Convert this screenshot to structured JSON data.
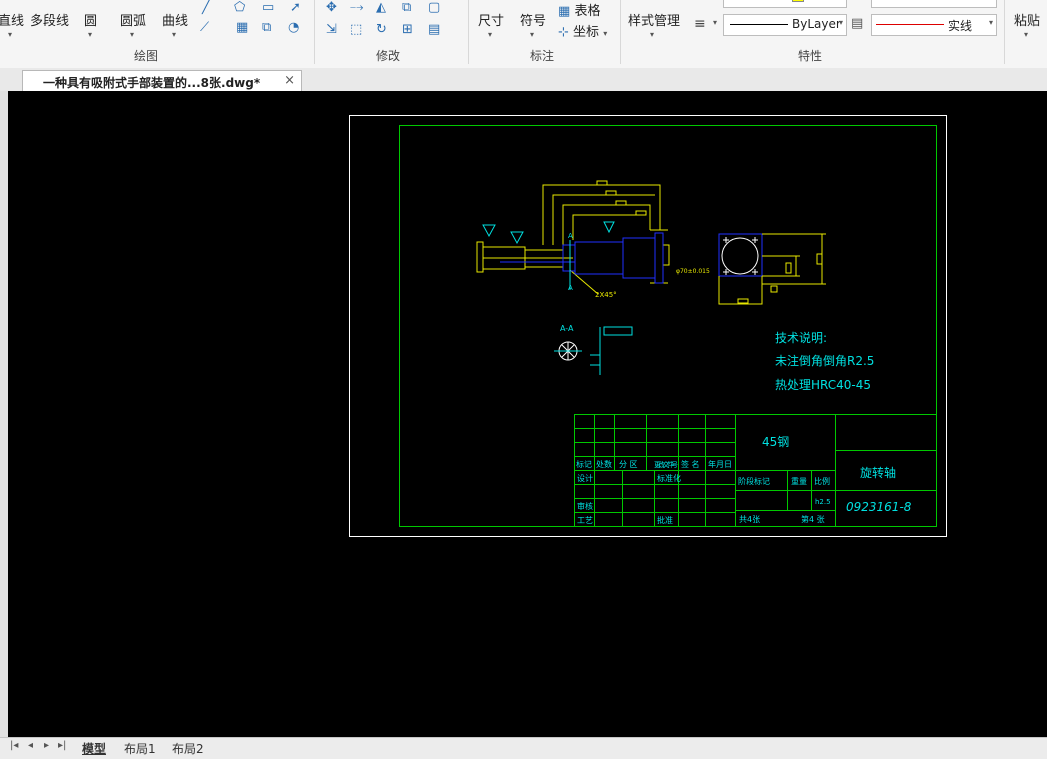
{
  "ribbon": {
    "draw_group": {
      "label": "绘图",
      "line": "直线",
      "polyline": "多段线",
      "circle": "圆",
      "arc": "圆弧",
      "curve": "曲线"
    },
    "modify_group": {
      "label": "修改"
    },
    "annotation_group": {
      "label": "标注",
      "dimension": "尺寸",
      "symbol": "符号",
      "table": "表格",
      "coordinate": "坐标"
    },
    "properties_group": {
      "label": "特性",
      "style_manager": "样式管理",
      "layer_value": "ByLayer",
      "linetype_value": "实线"
    },
    "clipboard": {
      "paste": "粘贴"
    }
  },
  "document_tab": {
    "title": "一种具有吸附式手部装置的...8张.dwg*"
  },
  "layout_tabs": [
    "模型",
    "布局1",
    "布局2"
  ],
  "drawing": {
    "tech_notes_title": "技术说明:",
    "tech_note_1": "未注倒角倒角R2.5",
    "tech_note_2": "热处理HRC40-45",
    "section_label": "A-A",
    "section_a_top": "A",
    "section_a_bottom": "A",
    "chamfer_label": "2X45°",
    "tolerance_label": "φ70±0.015",
    "material": "45钢",
    "part_name": "旋转轴",
    "drawing_number": "0923161-8",
    "scale_cell": "h2.5",
    "tb_row_headers": [
      "标记",
      "处数",
      "分 区",
      "更改文件号",
      "签 名",
      "年月日"
    ],
    "tb_design": "设计",
    "tb_standard": "标准化",
    "tb_review": "审核",
    "tb_process": "工艺",
    "tb_approve": "批准",
    "tb_stage": "阶段标记",
    "tb_weight": "重量",
    "tb_ratio": "比例",
    "tb_total": "共4张",
    "tb_sheet": "第4 张"
  },
  "colors": {
    "canvas": "#000000",
    "frame_green": "#00c800",
    "part_yellow": "#e8e800",
    "part_blue": "#2030ff",
    "text_cyan": "#00e0e0",
    "border_white": "#ffffff"
  }
}
